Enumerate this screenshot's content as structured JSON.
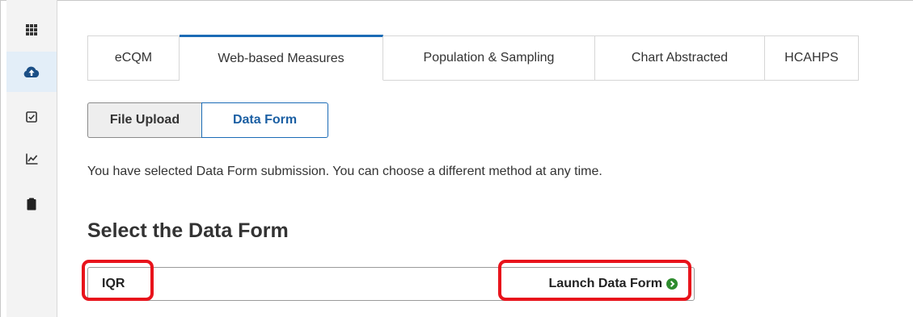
{
  "sidebar": {
    "items": [
      {
        "icon": "apps-grid-icon",
        "active": false
      },
      {
        "icon": "cloud-upload-icon",
        "active": true
      },
      {
        "icon": "checkbox-icon",
        "active": false
      },
      {
        "icon": "line-chart-icon",
        "active": false
      },
      {
        "icon": "clipboard-icon",
        "active": false
      }
    ]
  },
  "tabs": [
    {
      "label": "eCQM",
      "active": false
    },
    {
      "label": "Web-based Measures",
      "active": true
    },
    {
      "label": "Population & Sampling",
      "active": false
    },
    {
      "label": "Chart Abstracted",
      "active": false
    },
    {
      "label": "HCAHPS",
      "active": false
    }
  ],
  "method": {
    "file_upload_label": "File Upload",
    "data_form_label": "Data Form",
    "selected": "Data Form"
  },
  "info_text": "You have selected Data Form submission. You can choose a different method at any time.",
  "section_title": "Select the Data Form",
  "form_row": {
    "name": "IQR",
    "launch_label": "Launch Data Form"
  },
  "colors": {
    "accent": "#1b6bb6",
    "launch_icon": "#2e8b2e",
    "highlight": "#e8131b",
    "sidebar_bg": "#f3f3f3",
    "sidebar_active_bg": "#e3eef8"
  }
}
